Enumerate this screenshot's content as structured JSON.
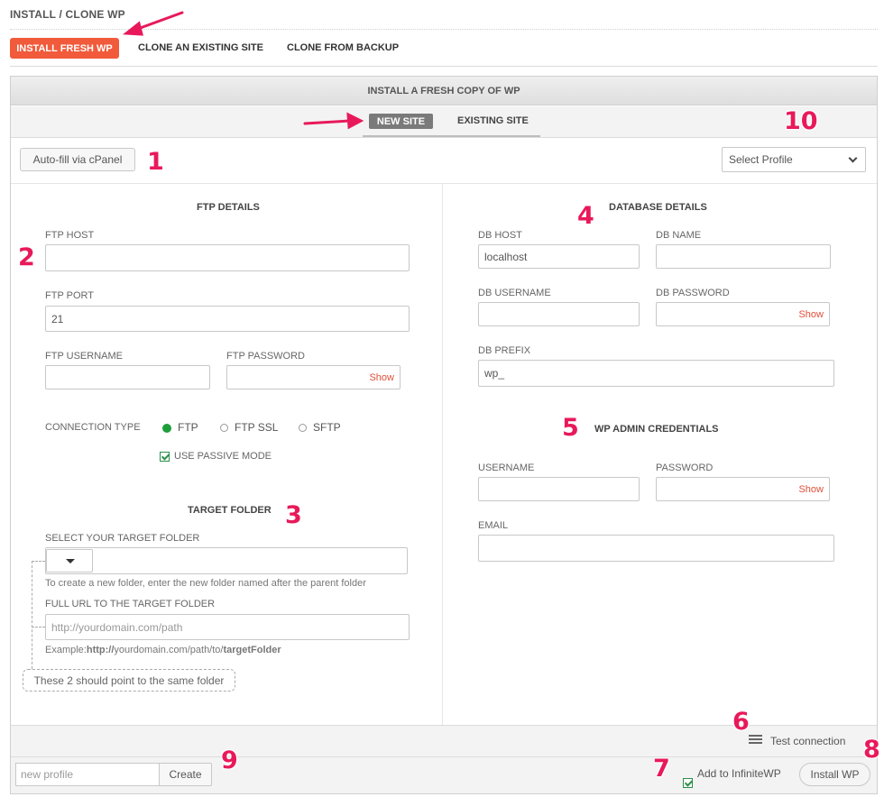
{
  "page": {
    "title": "INSTALL / CLONE WP"
  },
  "tabs": [
    {
      "label": "INSTALL FRESH WP",
      "active": true
    },
    {
      "label": "CLONE AN EXISTING SITE"
    },
    {
      "label": "CLONE FROM BACKUP"
    }
  ],
  "panel": {
    "title": "INSTALL A FRESH COPY OF WP",
    "subtabs": [
      {
        "label": "NEW SITE",
        "active": true
      },
      {
        "label": "EXISTING SITE"
      }
    ],
    "autofill_label": "Auto-fill via cPanel",
    "profile_select": "Select Profile"
  },
  "ftp": {
    "title": "FTP DETAILS",
    "host_label": "FTP HOST",
    "host_value": "",
    "port_label": "FTP PORT",
    "port_value": "21",
    "username_label": "FTP USERNAME",
    "username_value": "",
    "password_label": "FTP PASSWORD",
    "password_value": "",
    "show_label": "Show",
    "connection_type_label": "CONNECTION TYPE",
    "connection_options": [
      {
        "label": "FTP",
        "selected": true
      },
      {
        "label": "FTP SSL",
        "selected": false
      },
      {
        "label": "SFTP",
        "selected": false
      }
    ],
    "passive_label": "USE PASSIVE MODE",
    "passive_checked": true
  },
  "target": {
    "title": "TARGET FOLDER",
    "select_label": "SELECT YOUR TARGET FOLDER",
    "folder_path": "",
    "create_hint": "To create a new folder, enter the new folder named after the parent folder",
    "url_label": "FULL URL TO THE TARGET FOLDER",
    "url_placeholder": "http://yourdomain.com/path",
    "example_prefix": "Example:",
    "example_bold1": "http://",
    "example_mid": "yourdomain.com/path/to/",
    "example_bold2": "targetFolder",
    "note": "These 2 should point to the same folder"
  },
  "db": {
    "title": "DATABASE DETAILS",
    "host_label": "DB HOST",
    "host_value": "localhost",
    "name_label": "DB NAME",
    "name_value": "",
    "username_label": "DB USERNAME",
    "username_value": "",
    "password_label": "DB PASSWORD",
    "password_value": "",
    "show_label": "Show",
    "prefix_label": "DB PREFIX",
    "prefix_value": "wp_"
  },
  "admin": {
    "title": "WP ADMIN CREDENTIALS",
    "username_label": "USERNAME",
    "username_value": "",
    "password_label": "PASSWORD",
    "password_value": "",
    "show_label": "Show",
    "email_label": "EMAIL",
    "email_value": ""
  },
  "footer": {
    "test_connection": "Test connection",
    "new_profile_placeholder": "new profile",
    "create_label": "Create",
    "add_iwp_label": "Add to InfiniteWP",
    "add_iwp_checked": true,
    "install_label": "Install WP"
  },
  "annotations": [
    "1",
    "2",
    "3",
    "4",
    "5",
    "6",
    "7",
    "8",
    "9",
    "10"
  ],
  "colors": {
    "accent": "#f15a3a",
    "annotation": "#e8195a",
    "radio_on": "#1e9e3a",
    "show_link": "#e0503a"
  },
  "icons": [
    "server-icon",
    "chevron-down-icon",
    "checkbox-icon",
    "radio-icon",
    "arrow-pointer-icon"
  ]
}
